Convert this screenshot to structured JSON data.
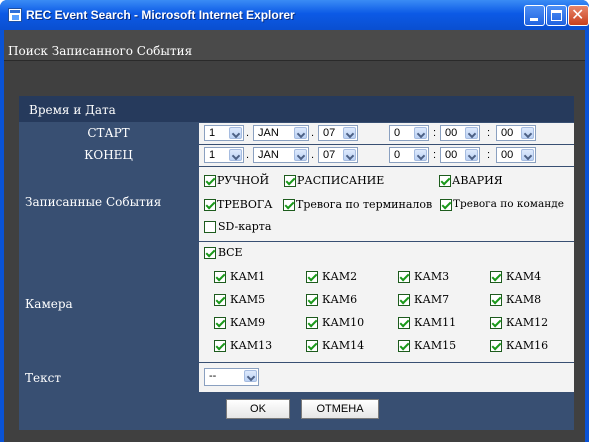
{
  "window": {
    "title": "REC Event Search - Microsoft Internet Explorer",
    "icon": "ie-window-icon",
    "controls": [
      "minimize-icon",
      "maximize-icon",
      "close-icon"
    ]
  },
  "page": {
    "caption": "Поиск Записанного События"
  },
  "form": {
    "section_title": "Время и Дата",
    "start": {
      "label": "СТАРТ",
      "day": "1",
      "month": "JAN",
      "year": "07",
      "hour": "0",
      "minute": "00",
      "second": "00"
    },
    "end": {
      "label": "КОНЕЦ",
      "day": "1",
      "month": "JAN",
      "year": "07",
      "hour": "0",
      "minute": "00",
      "second": "00"
    },
    "separators": {
      "date": ".",
      "time": ":"
    },
    "events": {
      "label": "Записанные События",
      "items": [
        {
          "label": "РУЧНОЙ",
          "checked": true
        },
        {
          "label": "РАСПИСАНИЕ",
          "checked": true
        },
        {
          "label": "АВАРИЯ",
          "checked": true
        },
        {
          "label": "ТРЕВОГА",
          "checked": true
        },
        {
          "label": "Тревога по терминалов",
          "checked": true
        },
        {
          "label": "Тревога по команде",
          "checked": true
        },
        {
          "label": "SD-карта",
          "checked": false
        }
      ]
    },
    "camera": {
      "label": "Камера",
      "all": {
        "label": "ВСЕ",
        "checked": true
      },
      "cams": [
        "КАМ1",
        "КАМ2",
        "КАМ3",
        "КАМ4",
        "КАМ5",
        "КАМ6",
        "КАМ7",
        "КАМ8",
        "КАМ9",
        "КАМ10",
        "КАМ11",
        "КАМ12",
        "КАМ13",
        "КАМ14",
        "КАМ15",
        "КАМ16"
      ],
      "cams_checked": true
    },
    "text": {
      "label": "Текст",
      "value": "--"
    }
  },
  "buttons": {
    "ok": "OK",
    "cancel": "ОТМЕНА"
  },
  "colors": {
    "title_bar": "#0c5ae6",
    "panel": "#384f72",
    "panel_header": "#263a5c",
    "background": "#404040",
    "checkmark": "#1a9a1a"
  }
}
